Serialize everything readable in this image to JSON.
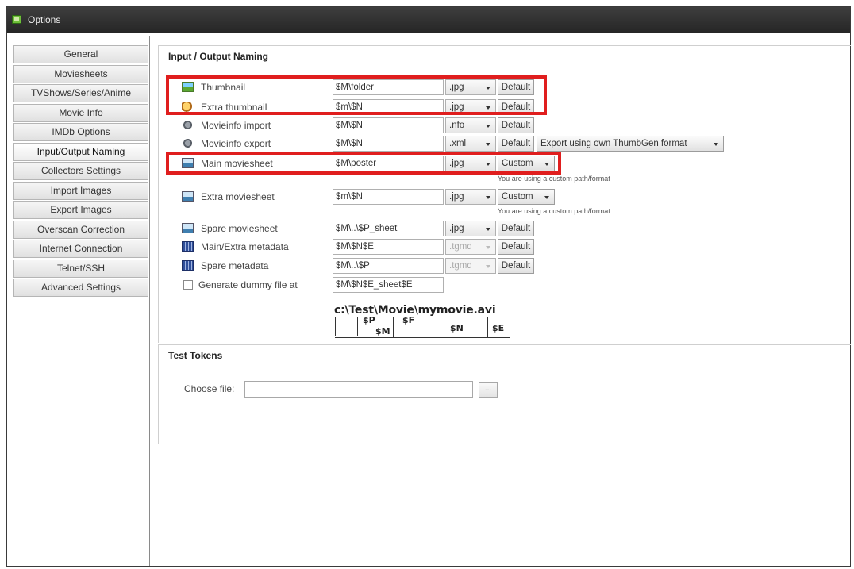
{
  "window": {
    "title": "Options"
  },
  "nav": {
    "items": [
      "General",
      "Moviesheets",
      "TVShows/Series/Anime",
      "Movie Info",
      "IMDb Options",
      "Input/Output Naming",
      "Collectors Settings",
      "Import Images",
      "Export Images",
      "Overscan Correction",
      "Internet Connection",
      "Telnet/SSH",
      "Advanced Settings"
    ],
    "active": "Input/Output Naming"
  },
  "io": {
    "title": "Input / Output Naming",
    "rows": {
      "thumbnail": {
        "label": "Thumbnail",
        "value": "$M\\folder",
        "ext": ".jpg",
        "button": "Default"
      },
      "extra_thumbnail": {
        "label": "Extra thumbnail",
        "value": "$m\\$N",
        "ext": ".jpg",
        "button": "Default"
      },
      "movieinfo_import": {
        "label": "Movieinfo import",
        "value": "$M\\$N",
        "ext": ".nfo",
        "button": "Default"
      },
      "movieinfo_export": {
        "label": "Movieinfo export",
        "value": "$M\\$N",
        "ext": ".xml",
        "button": "Default",
        "format": "Export using own ThumbGen format"
      },
      "main_moviesheet": {
        "label": "Main moviesheet",
        "value": "$M\\poster",
        "ext": ".jpg",
        "button": "Custom",
        "note": "You are using a custom path/format"
      },
      "extra_moviesheet": {
        "label": "Extra moviesheet",
        "value": "$m\\$N",
        "ext": ".jpg",
        "button": "Custom",
        "note": "You are using a custom path/format"
      },
      "spare_moviesheet": {
        "label": "Spare moviesheet",
        "value": "$M\\..\\$P_sheet",
        "ext": ".jpg",
        "button": "Default"
      },
      "main_extra_metadata": {
        "label": "Main/Extra metadata",
        "value": "$M\\$N$E",
        "ext": ".tgmd",
        "button": "Default"
      },
      "spare_metadata": {
        "label": "Spare metadata",
        "value": "$M\\..\\$P",
        "ext": ".tgmd",
        "button": "Default"
      },
      "dummy_file": {
        "label": "Generate dummy file at",
        "value": "$M\\$N$E_sheet$E"
      }
    },
    "example": {
      "path": "c:\\Test\\Movie\\mymovie.avi",
      "tokens": {
        "p": "$P",
        "m": "$M",
        "f": "$F",
        "n": "$N",
        "e": "$E"
      }
    }
  },
  "test": {
    "title": "Test Tokens",
    "choose_label": "Choose file:",
    "choose_value": "",
    "browse_label": "..."
  },
  "colors": {
    "highlight": "#e01e1e",
    "titlebar": "#2e2e2e"
  }
}
